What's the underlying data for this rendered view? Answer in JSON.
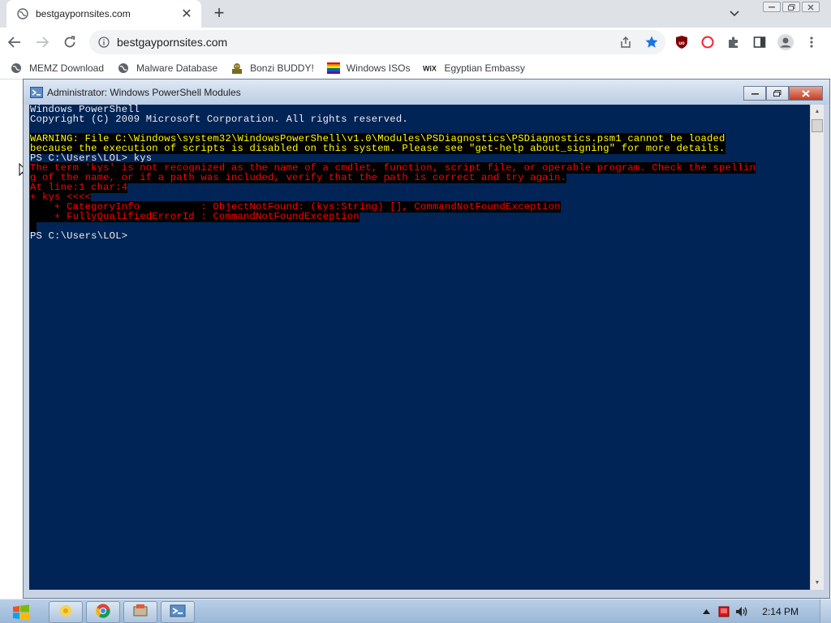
{
  "browser": {
    "tab": {
      "title": "bestgaypornsites.com",
      "close": "✕"
    },
    "new_tab": "+",
    "omnibox": {
      "url": "bestgaypornsites.com"
    },
    "bookmarks": [
      {
        "label": "MEMZ Download",
        "icon": "globe-icon"
      },
      {
        "label": "Malware Database",
        "icon": "globe-icon"
      },
      {
        "label": "Bonzi BUDDY!",
        "icon": "bonzi-icon"
      },
      {
        "label": "Windows ISOs",
        "icon": "windows-flag-icon"
      },
      {
        "label": "Egyptian Embassy",
        "icon": "wix-icon"
      }
    ],
    "wix_text": "WiX"
  },
  "powershell": {
    "title": "Administrator: Windows PowerShell Modules",
    "lines": [
      {
        "text": "Windows PowerShell",
        "style": "normal"
      },
      {
        "text": "Copyright (C) 2009 Microsoft Corporation. All rights reserved.",
        "style": "normal"
      },
      {
        "text": "",
        "style": "normal"
      },
      {
        "text": "WARNING: File C:\\Windows\\system32\\WindowsPowerShell\\v1.0\\Modules\\PSDiagnostics\\PSDiagnostics.psm1 cannot be loaded",
        "style": "warn"
      },
      {
        "text": "because the execution of scripts is disabled on this system. Please see \"get-help about_signing\" for more details.",
        "style": "warn"
      },
      {
        "text": "PS C:\\Users\\LOL> kys",
        "style": "normal"
      },
      {
        "text": "The term 'kys' is not recognized as the name of a cmdlet, function, script file, or operable program. Check the spellin",
        "style": "err"
      },
      {
        "text": "g of the name, or if a path was included, verify that the path is correct and try again.",
        "style": "err"
      },
      {
        "text": "At line:1 char:4",
        "style": "err"
      },
      {
        "text": "+ kys <<<<",
        "style": "err"
      },
      {
        "text": "    + CategoryInfo          : ObjectNotFound: (kys:String) [], CommandNotFoundException",
        "style": "err"
      },
      {
        "text": "    + FullyQualifiedErrorId : CommandNotFoundException",
        "style": "err"
      },
      {
        "text": " ",
        "style": "err"
      },
      {
        "text": "PS C:\\Users\\LOL>",
        "style": "normal"
      }
    ]
  },
  "taskbar": {
    "clock": "2:14 PM"
  },
  "colors": {
    "console_bg": "#012456",
    "warning": "#ffff00",
    "error": "#ff0000",
    "bookmark_star": "#1a73e8"
  }
}
